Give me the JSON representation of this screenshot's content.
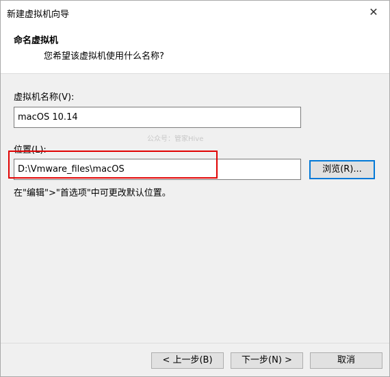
{
  "window": {
    "title": "新建虚拟机向导"
  },
  "header": {
    "title": "命名虚拟机",
    "subtitle": "您希望该虚拟机使用什么名称?"
  },
  "vm_name": {
    "label": "虚拟机名称(V):",
    "value": "macOS 10.14"
  },
  "location": {
    "label": "位置(L):",
    "value": "D:\\Vmware_files\\macOS",
    "browse_label": "浏览(R)..."
  },
  "hint": "在\"编辑\">\"首选项\"中可更改默认位置。",
  "watermark": "公众号：管家Hive",
  "footer": {
    "back_label": "< 上一步(B)",
    "next_label": "下一步(N) >",
    "cancel_label": "取消"
  },
  "colors": {
    "highlight": "#e00000",
    "default_button_border": "#0078d7"
  }
}
